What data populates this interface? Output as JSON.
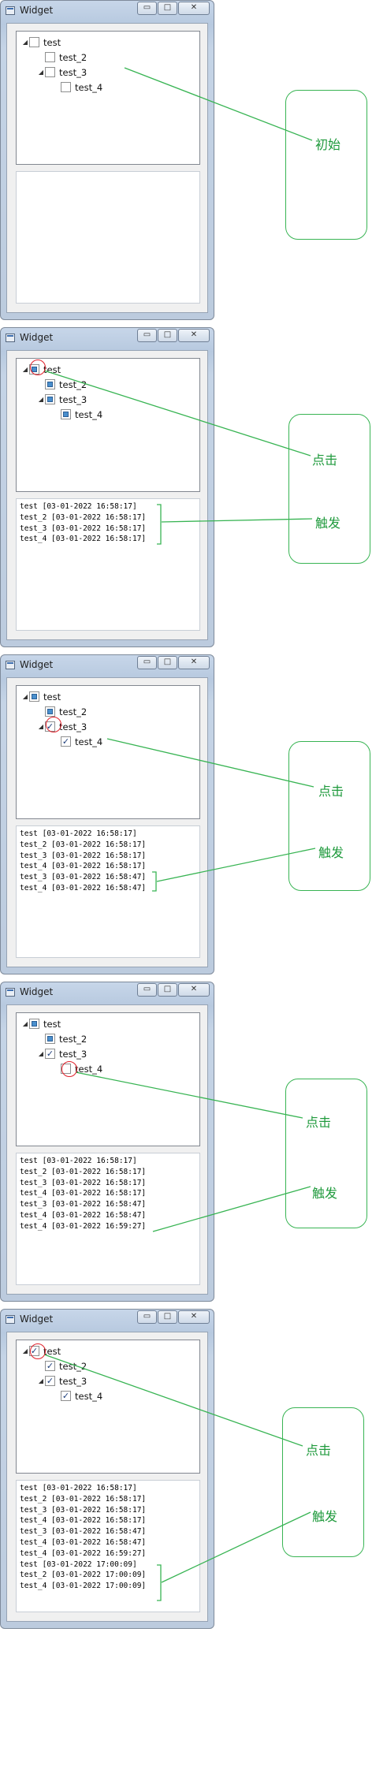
{
  "window": {
    "title": "Widget",
    "minimize_glyph": "▭",
    "maximize_glyph": "□",
    "close_glyph": "✕"
  },
  "labels": {
    "initial": "初始",
    "click": "点击",
    "trigger": "触发"
  },
  "accent_colors": {
    "annotation": "#38b453",
    "highlight_circle": "#e0212b"
  },
  "panels": [
    {
      "tree": [
        {
          "label": "test",
          "state": "unchecked",
          "expander": "expanded"
        },
        {
          "label": "test_2",
          "state": "unchecked",
          "expander": "none"
        },
        {
          "label": "test_3",
          "state": "unchecked",
          "expander": "expanded"
        },
        {
          "label": "test_4",
          "state": "unchecked",
          "expander": "none"
        }
      ],
      "log": []
    },
    {
      "tree": [
        {
          "label": "test",
          "state": "partial",
          "expander": "expanded"
        },
        {
          "label": "test_2",
          "state": "partial",
          "expander": "none"
        },
        {
          "label": "test_3",
          "state": "partial",
          "expander": "expanded"
        },
        {
          "label": "test_4",
          "state": "partial",
          "expander": "none"
        }
      ],
      "log": [
        "test [03-01-2022 16:58:17]",
        "test_2 [03-01-2022 16:58:17]",
        "test_3 [03-01-2022 16:58:17]",
        "test_4 [03-01-2022 16:58:17]"
      ]
    },
    {
      "tree": [
        {
          "label": "test",
          "state": "partial",
          "expander": "expanded"
        },
        {
          "label": "test_2",
          "state": "partial",
          "expander": "none"
        },
        {
          "label": "test_3",
          "state": "checked",
          "expander": "expanded"
        },
        {
          "label": "test_4",
          "state": "checked",
          "expander": "none"
        }
      ],
      "log": [
        "test [03-01-2022 16:58:17]",
        "test_2 [03-01-2022 16:58:17]",
        "test_3 [03-01-2022 16:58:17]",
        "test_4 [03-01-2022 16:58:17]",
        "test_3 [03-01-2022 16:58:47]",
        "test_4 [03-01-2022 16:58:47]"
      ]
    },
    {
      "tree": [
        {
          "label": "test",
          "state": "partial",
          "expander": "expanded"
        },
        {
          "label": "test_2",
          "state": "partial",
          "expander": "none"
        },
        {
          "label": "test_3",
          "state": "checked",
          "expander": "expanded"
        },
        {
          "label": "test_4",
          "state": "unchecked",
          "expander": "none"
        }
      ],
      "log": [
        "test [03-01-2022 16:58:17]",
        "test_2 [03-01-2022 16:58:17]",
        "test_3 [03-01-2022 16:58:17]",
        "test_4 [03-01-2022 16:58:17]",
        "test_3 [03-01-2022 16:58:47]",
        "test_4 [03-01-2022 16:58:47]",
        "test_4 [03-01-2022 16:59:27]"
      ]
    },
    {
      "tree": [
        {
          "label": "test",
          "state": "checked",
          "expander": "expanded"
        },
        {
          "label": "test_2",
          "state": "checked",
          "expander": "none"
        },
        {
          "label": "test_3",
          "state": "checked",
          "expander": "expanded"
        },
        {
          "label": "test_4",
          "state": "checked",
          "expander": "none"
        }
      ],
      "log": [
        "test [03-01-2022 16:58:17]",
        "test_2 [03-01-2022 16:58:17]",
        "test_3 [03-01-2022 16:58:17]",
        "test_4 [03-01-2022 16:58:17]",
        "test_3 [03-01-2022 16:58:47]",
        "test_4 [03-01-2022 16:58:47]",
        "test_4 [03-01-2022 16:59:27]",
        "test [03-01-2022 17:00:09]",
        "test_2 [03-01-2022 17:00:09]",
        "test_4 [03-01-2022 17:00:09]"
      ]
    }
  ]
}
